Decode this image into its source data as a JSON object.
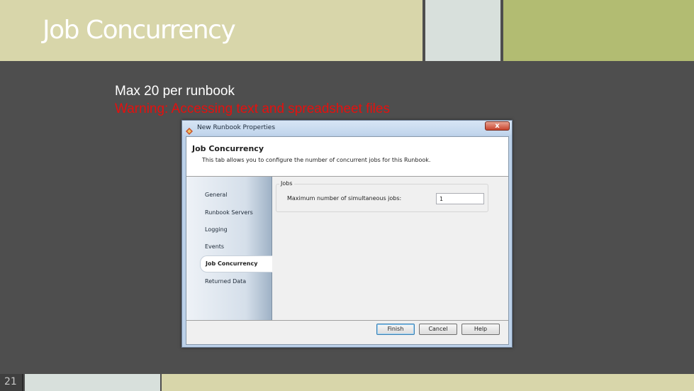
{
  "slide": {
    "title": "Job Concurrency",
    "line1": "Max 20 per runbook",
    "line2": "Warning: Accessing text and spreadsheet files",
    "number": "21"
  },
  "dialog": {
    "window_title": "New Runbook Properties",
    "close_label": "x",
    "header_title": "Job Concurrency",
    "header_subtitle": "This tab allows you to configure the number of concurrent jobs for this Runbook.",
    "nav": [
      "General",
      "Runbook Servers",
      "Logging",
      "Events",
      "Job Concurrency",
      "Returned Data"
    ],
    "active_nav": "Job Concurrency",
    "group_label": "Jobs",
    "field_label": "Maximum number of simultaneous jobs:",
    "field_value": "1",
    "buttons": {
      "finish": "Finish",
      "cancel": "Cancel",
      "help": "Help"
    }
  },
  "colors": {
    "header_left": "#d8d6aa",
    "header_middle": "#d8e0dc",
    "header_right": "#b2bc72",
    "background": "#4e4e4e",
    "warning": "#e5100e"
  }
}
